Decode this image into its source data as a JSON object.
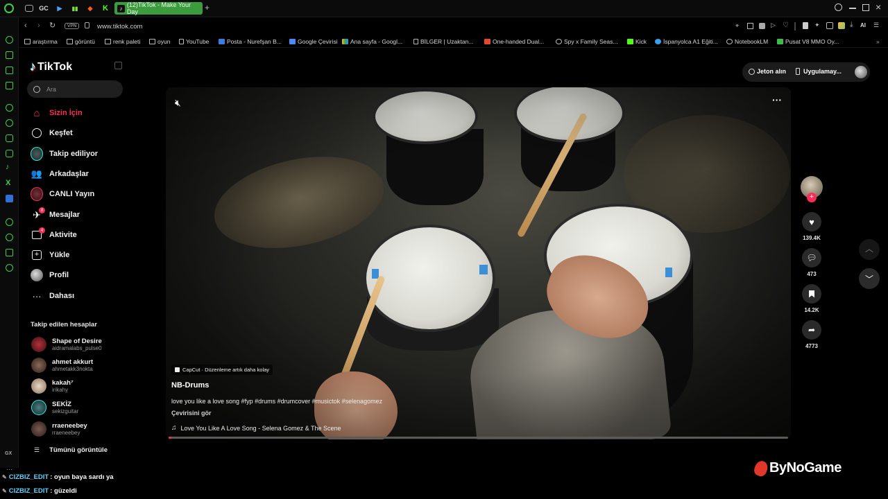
{
  "browser": {
    "active_tab_title": "(12)TikTok - Make Your Day",
    "tab_icon_labels": [
      "GC"
    ],
    "vpn_label": "VPN",
    "url": "www.tiktok.com",
    "ai_label": "AI",
    "bookmarks": [
      "araştırma",
      "görüntü",
      "renk paleti",
      "oyun",
      "YouTube",
      "Posta - Nurefşan B...",
      "Google Çevirisi",
      "Ana sayfa - Googl...",
      "BİLGER | Uzaktan...",
      "One-handed Dual...",
      "Spy x Family Seas...",
      "Kick",
      "İspanyolca A1 Eğiti...",
      "NotebookLM",
      "Pusat V8 MMO Oy..."
    ],
    "side_label": "GX"
  },
  "tiktok": {
    "logo": "TikTok",
    "search_placeholder": "Ara",
    "nav": [
      {
        "label": "Sizin İçin",
        "icon": "home-icon",
        "active": true
      },
      {
        "label": "Keşfet",
        "icon": "compass-icon"
      },
      {
        "label": "Takip ediliyor",
        "icon": "following-icon"
      },
      {
        "label": "Arkadaşlar",
        "icon": "friends-icon"
      },
      {
        "label": "CANLI Yayın",
        "icon": "live-icon"
      },
      {
        "label": "Mesajlar",
        "icon": "messages-icon",
        "badge": "8"
      },
      {
        "label": "Aktivite",
        "icon": "activity-icon",
        "badge": "4"
      },
      {
        "label": "Yükle",
        "icon": "upload-icon"
      },
      {
        "label": "Profil",
        "icon": "profile-icon"
      },
      {
        "label": "Dahası",
        "icon": "more-icon"
      }
    ],
    "following_header": "Takip edilen hesaplar",
    "following": [
      {
        "name": "Shape of Desire",
        "user": "aidramalabs_pulse0"
      },
      {
        "name": "ahmet akkurt",
        "user": "ahmetakk3nokta"
      },
      {
        "name": "kakah⁷",
        "user": "irikahy"
      },
      {
        "name": "SEKİZ",
        "user": "sekizguitar"
      },
      {
        "name": "rraeneebey",
        "user": "rraeneebey"
      }
    ],
    "see_all": "Tümünü görüntüle",
    "top_actions": {
      "coins": "Jeton alın",
      "app": "Uygulamay..."
    },
    "video": {
      "capcut": "CapCut · Düzenleme artık daha kolay",
      "author": "NB-Drums",
      "caption": "love you like a love song #fyp #drums #drumcover #musictok #selenagomez",
      "translate": "Çevirisini gör",
      "music": "Love You Like A Love Song - Selena Gomez & The Scene",
      "progress": 0.0
    },
    "stats": {
      "likes": "139.4K",
      "comments": "473",
      "saves": "14.2K",
      "shares": "4773"
    }
  },
  "chat": [
    {
      "user": "CIZBIZ_EDIT",
      "msg": ": oyun baya sardı ya"
    },
    {
      "user": "CIZBIZ_EDIT",
      "msg": ": güzeldi"
    }
  ],
  "watermark": "ByNoGame",
  "colors": {
    "accent": "#fe2c55",
    "opera_green": "#39d24a",
    "active_tab": "#3b9b3d",
    "chat_user": "#5fd3ff"
  }
}
